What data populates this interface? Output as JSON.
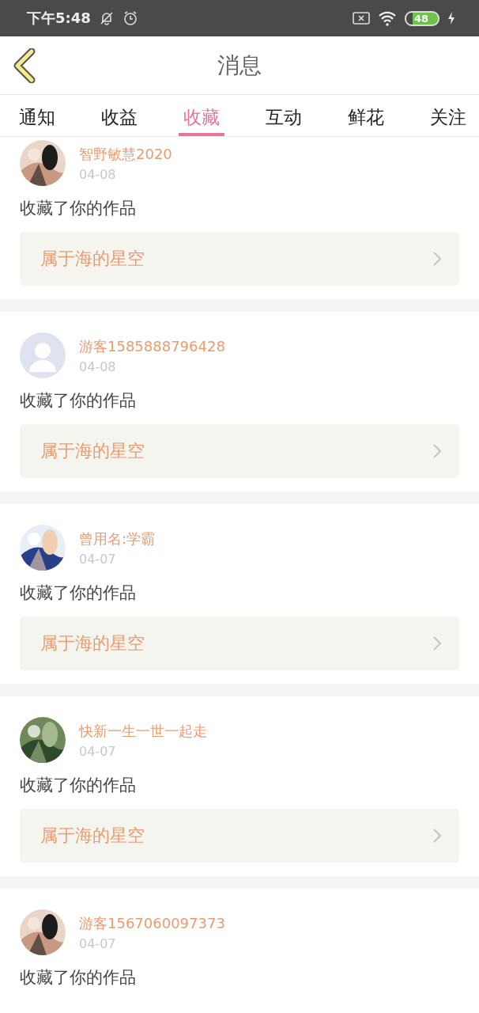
{
  "status_bar": {
    "time": "下午5:48",
    "battery": "48"
  },
  "header": {
    "title": "消息"
  },
  "tabs": [
    {
      "label": "通知",
      "selected": false
    },
    {
      "label": "收益",
      "selected": false
    },
    {
      "label": "收藏",
      "selected": true
    },
    {
      "label": "互动",
      "selected": false
    },
    {
      "label": "鲜花",
      "selected": false
    },
    {
      "label": "关注",
      "selected": false
    }
  ],
  "messages": [
    {
      "user": "智野敏慧2020",
      "date": "04-08",
      "text": "收藏了你的作品",
      "work": "属于海的星空"
    },
    {
      "user": "游客1585888796428",
      "date": "04-08",
      "text": "收藏了你的作品",
      "work": "属于海的星空",
      "avatar": {
        "kind": "default"
      }
    },
    {
      "user": "曾用名:学霸",
      "date": "04-07",
      "text": "收藏了你的作品",
      "work": "属于海的星空"
    },
    {
      "user": "快新一生一世一起走",
      "date": "04-07",
      "text": "收藏了你的作品",
      "work": "属于海的星空"
    },
    {
      "user": "游客1567060097373",
      "date": "04-07",
      "text": "收藏了你的作品"
    }
  ]
}
